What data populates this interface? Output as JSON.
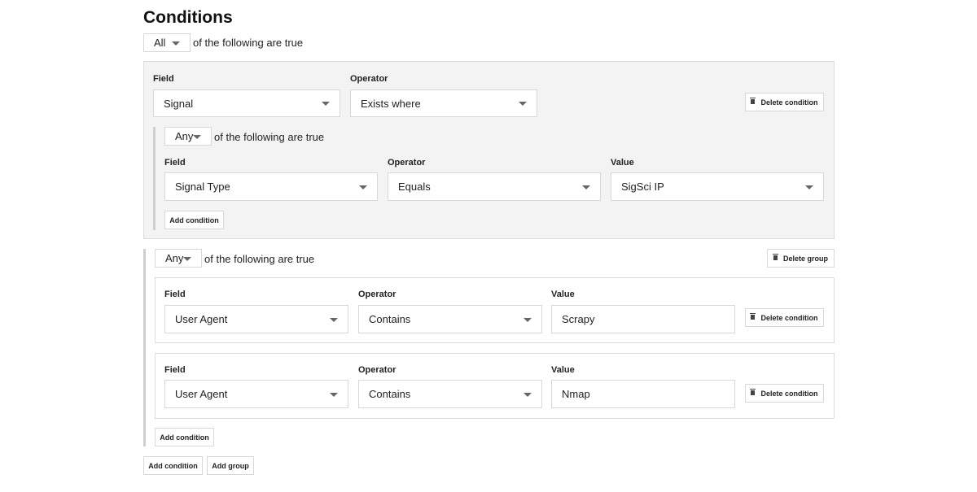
{
  "title": "Conditions",
  "root": {
    "match": "All",
    "suffix": "of the following are true",
    "add_condition": "Add condition",
    "add_group": "Add group"
  },
  "condition1": {
    "field_label": "Field",
    "field_value": "Signal",
    "operator_label": "Operator",
    "operator_value": "Exists where",
    "delete": "Delete condition",
    "nested": {
      "match": "Any",
      "suffix": "of the following are true",
      "field_label": "Field",
      "field_value": "Signal Type",
      "operator_label": "Operator",
      "operator_value": "Equals",
      "value_label": "Value",
      "value_value": "SigSci IP",
      "add_condition": "Add condition"
    }
  },
  "group": {
    "match": "Any",
    "suffix": "of the following are true",
    "delete": "Delete group",
    "add_condition": "Add condition",
    "conditions": [
      {
        "field_label": "Field",
        "field_value": "User Agent",
        "operator_label": "Operator",
        "operator_value": "Contains",
        "value_label": "Value",
        "value_value": "Scrapy",
        "delete": "Delete condition"
      },
      {
        "field_label": "Field",
        "field_value": "User Agent",
        "operator_label": "Operator",
        "operator_value": "Contains",
        "value_label": "Value",
        "value_value": "Nmap",
        "delete": "Delete condition"
      }
    ]
  },
  "icons": {
    "dropdown": "chevron-down-icon",
    "delete": "trash-icon"
  }
}
